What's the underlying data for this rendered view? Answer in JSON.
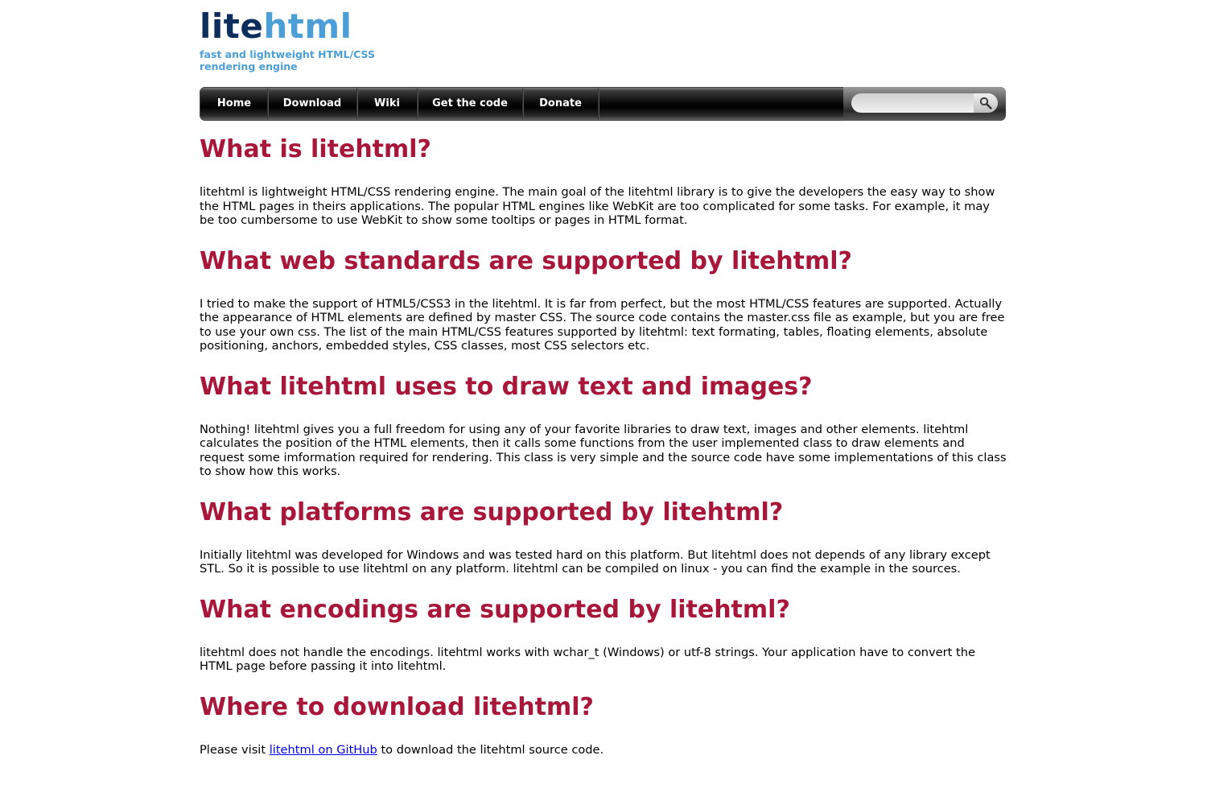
{
  "header": {
    "logo_part1": "lite",
    "logo_part2": "html",
    "tagline": "fast and lightweight HTML/CSS rendering engine"
  },
  "nav": {
    "items": [
      {
        "label": "Home"
      },
      {
        "label": "Download"
      },
      {
        "label": "Wiki"
      },
      {
        "label": "Get the code"
      },
      {
        "label": "Donate"
      }
    ],
    "search_placeholder": "",
    "search_icon": "magnifier-icon"
  },
  "sections": [
    {
      "title": "What is litehtml?",
      "text": "litehtml is lightweight HTML/CSS rendering engine. The main goal of the litehtml library is to give the developers the easy way to show the HTML pages in theirs applications. The popular HTML engines like WebKit are too complicated for some tasks. For example, it may be too cumbersome to use WebKit to show some tooltips or pages in HTML format."
    },
    {
      "title": "What web standards are supported by litehtml?",
      "text": "I tried to make the support of HTML5/CSS3 in the litehtml. It is far from perfect, but the most HTML/CSS features are supported. Actually the appearance of HTML elements are defined by master CSS. The source code contains the master.css file as example, but you are free to use your own css. The list of the main HTML/CSS features supported by litehtml: text formating, tables, floating elements, absolute positioning, anchors, embedded styles, CSS classes, most CSS selectors etc."
    },
    {
      "title": "What litehtml uses to draw text and images?",
      "text": "Nothing! litehtml gives you a full freedom for using any of your favorite libraries to draw text, images and other elements. litehtml calculates the position of the HTML elements, then it calls some functions from the user implemented class to draw elements and request some imformation required for rendering. This class is very simple and the source code have some implementations of this class to show how this works."
    },
    {
      "title": "What platforms are supported by litehtml?",
      "text": "Initially litehtml was developed for Windows and was tested hard on this platform. But litehtml does not depends of any library except STL. So it is possible to use litehtml on any platform. litehtml can be compiled on linux - you can find the example in the sources."
    },
    {
      "title": "What encodings are supported by litehtml?",
      "text": "litehtml does not handle the encodings. litehtml works with wchar_t (Windows) or utf-8 strings. Your application have to convert the HTML page before passing it into litehtml."
    },
    {
      "title": "Where to download litehtml?",
      "text_before": "Please visit ",
      "link_text": "litehtml on GitHub",
      "text_after": " to download the litehtml source code."
    }
  ],
  "colors": {
    "heading": "#a8173a",
    "logo_dark": "#0b2e5c",
    "logo_light": "#4b9fd6",
    "link": "#0000ee"
  }
}
